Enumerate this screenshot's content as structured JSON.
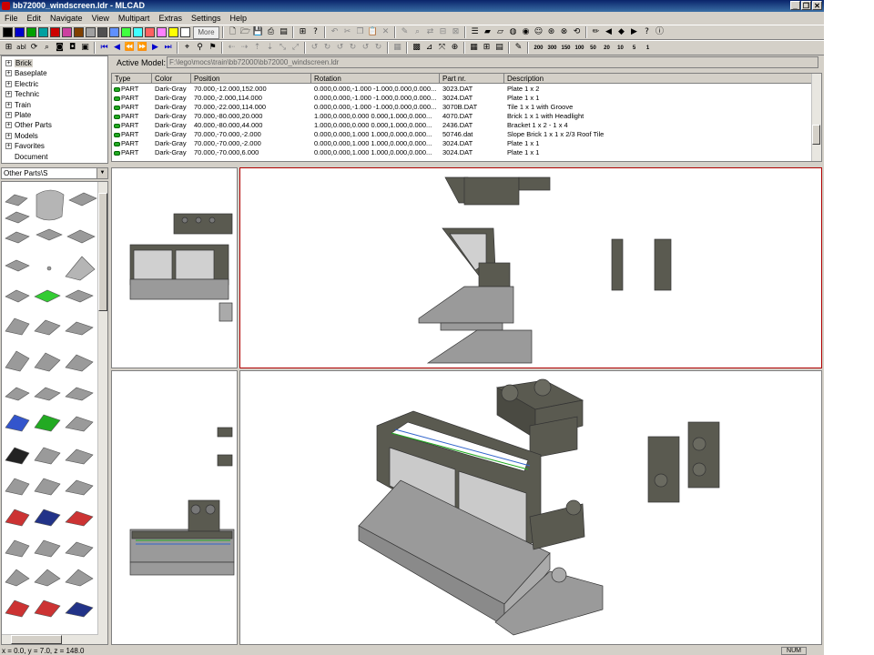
{
  "window": {
    "title": "bb72000_windscreen.ldr - MLCAD",
    "min_glyph": "_",
    "max_glyph": "❐",
    "close_glyph": "✕"
  },
  "menu": [
    "File",
    "Edit",
    "Navigate",
    "View",
    "Multipart",
    "Extras",
    "Settings",
    "Help"
  ],
  "toolbar": {
    "colors": [
      "#000000",
      "#0000cc",
      "#00a000",
      "#00a0a0",
      "#cc0000",
      "#cc40a0",
      "#804000",
      "#a0a0a0",
      "#505050",
      "#6090ff",
      "#40ff40",
      "#40ffff",
      "#ff6060",
      "#ff80ff",
      "#ffff00",
      "#ffffff"
    ],
    "more_label": "More",
    "rotation_steps": [
      "200",
      "300",
      "150",
      "100",
      "50",
      "20",
      "10",
      "5",
      "1"
    ]
  },
  "tree": {
    "items": [
      {
        "label": "Brick",
        "selected": true
      },
      {
        "label": "Baseplate"
      },
      {
        "label": "Electric"
      },
      {
        "label": "Technic"
      },
      {
        "label": "Train"
      },
      {
        "label": "Plate"
      },
      {
        "label": "Other Parts"
      },
      {
        "label": "Models"
      },
      {
        "label": "Favorites"
      },
      {
        "label": "Document",
        "leaf": true
      }
    ]
  },
  "palette": {
    "filter": "Other Parts\\S"
  },
  "active_model": {
    "label": "Active Model:",
    "path": "F:\\lego\\mocs\\train\\bb72000\\bb72000_windscreen.ldr"
  },
  "parts_list": {
    "columns": [
      "Type",
      "Color",
      "Position",
      "Rotation",
      "Part nr.",
      "Description"
    ],
    "rows": [
      [
        "PART",
        "Dark-Gray",
        "70.000,-12.000,152.000",
        "0.000,0.000,-1.000 -1.000,0.000,0.000...",
        "3023.DAT",
        "Plate  1 x 2"
      ],
      [
        "PART",
        "Dark-Gray",
        "70.000,-2.000,114.000",
        "0.000,0.000,-1.000 -1.000,0.000,0.000...",
        "3024.DAT",
        "Plate  1 x 1"
      ],
      [
        "PART",
        "Dark-Gray",
        "70.000,-22.000,114.000",
        "0.000,0.000,-1.000 -1.000,0.000,0.000...",
        "3070B.DAT",
        "Tile  1 x 1 with Groove"
      ],
      [
        "PART",
        "Dark-Gray",
        "70.000,-80.000,20.000",
        "1.000,0.000,0.000 0.000,1.000,0.000...",
        "4070.DAT",
        "Brick  1 x 1 with Headlight"
      ],
      [
        "PART",
        "Dark-Gray",
        "40.000,-80.000,44.000",
        "1.000,0.000,0.000 0.000,1.000,0.000...",
        "2436.DAT",
        "Bracket  1 x 2 - 1 x 4"
      ],
      [
        "PART",
        "Dark-Gray",
        "70.000,-70.000,-2.000",
        "0.000,0.000,1.000 1.000,0.000,0.000...",
        "50746.dat",
        "Slope Brick  1 x 1 x 2/3 Roof Tile"
      ],
      [
        "PART",
        "Dark-Gray",
        "70.000,-70.000,-2.000",
        "0.000,0.000,1.000 1.000,0.000,0.000...",
        "3024.DAT",
        "Plate  1 x 1"
      ],
      [
        "PART",
        "Dark-Gray",
        "70.000,-70.000,6.000",
        "0.000,0.000,1.000 1.000,0.000,0.000...",
        "3024.DAT",
        "Plate  1 x 1"
      ]
    ]
  },
  "status": {
    "coords": "x = 0.0, y = 7.0, z = 148.0",
    "num": "NUM"
  }
}
